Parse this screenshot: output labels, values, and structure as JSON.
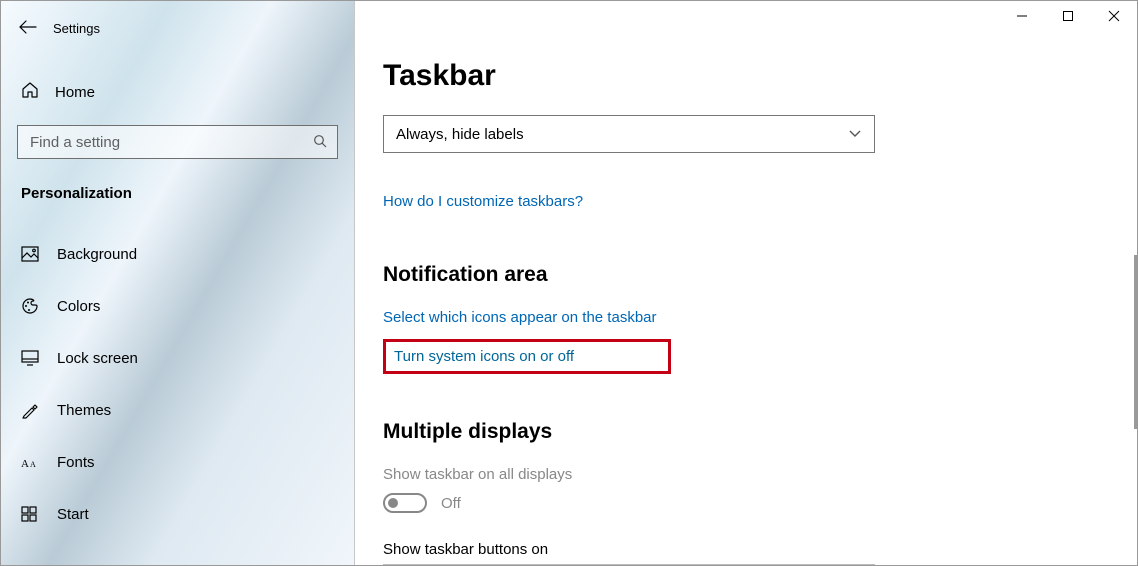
{
  "header": {
    "app_title": "Settings"
  },
  "sidebar": {
    "home_label": "Home",
    "search_placeholder": "Find a setting",
    "section_label": "Personalization",
    "items": [
      {
        "label": "Background"
      },
      {
        "label": "Colors"
      },
      {
        "label": "Lock screen"
      },
      {
        "label": "Themes"
      },
      {
        "label": "Fonts"
      },
      {
        "label": "Start"
      }
    ]
  },
  "main": {
    "page_title": "Taskbar",
    "combo_value": "Always, hide labels",
    "help_link": "How do I customize taskbars?",
    "section_notification": "Notification area",
    "link_select_icons": "Select which icons appear on the taskbar",
    "link_system_icons": "Turn system icons on or off",
    "section_multiple": "Multiple displays",
    "show_all_label": "Show taskbar on all displays",
    "toggle_state": "Off",
    "show_buttons_label": "Show taskbar buttons on"
  }
}
